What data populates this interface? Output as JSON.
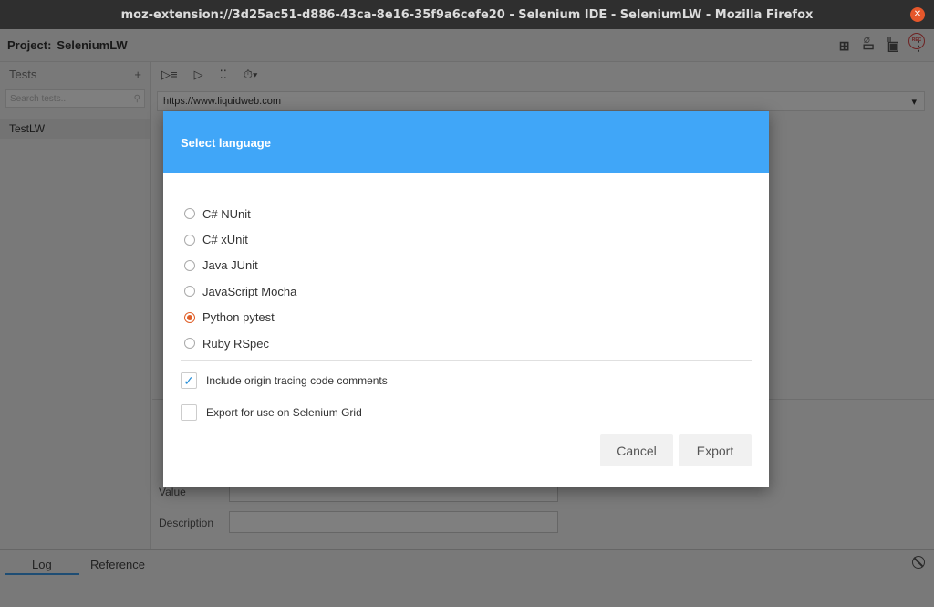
{
  "window": {
    "title": "moz-extension://3d25ac51-d886-43ca-8e16-35f9a6cefe20 - Selenium IDE - SeleniumLW - Mozilla Firefox"
  },
  "project": {
    "label": "Project:",
    "name": "SeleniumLW"
  },
  "sidebar": {
    "header": "Tests",
    "search_placeholder": "Search tests...",
    "items": [
      {
        "label": "TestLW"
      }
    ]
  },
  "url": "https://www.liquidweb.com",
  "form": {
    "value_label": "Value",
    "description_label": "Description"
  },
  "bottom_tabs": [
    "Log",
    "Reference"
  ],
  "dialog": {
    "title": "Select language",
    "languages": [
      {
        "label": "C# NUnit",
        "selected": false
      },
      {
        "label": "C# xUnit",
        "selected": false
      },
      {
        "label": "Java JUnit",
        "selected": false
      },
      {
        "label": "JavaScript Mocha",
        "selected": false
      },
      {
        "label": "Python pytest",
        "selected": true
      },
      {
        "label": "Ruby RSpec",
        "selected": false
      }
    ],
    "options": {
      "origin_tracing": {
        "label": "Include origin tracing code comments",
        "checked": true
      },
      "selenium_grid": {
        "label": "Export for use on Selenium Grid",
        "checked": false
      }
    },
    "cancel_label": "Cancel",
    "export_label": "Export"
  },
  "colors": {
    "dialog_header": "#40a6f8",
    "radio_selected": "#e0602a",
    "checkbox_check": "#2a8fd8"
  }
}
